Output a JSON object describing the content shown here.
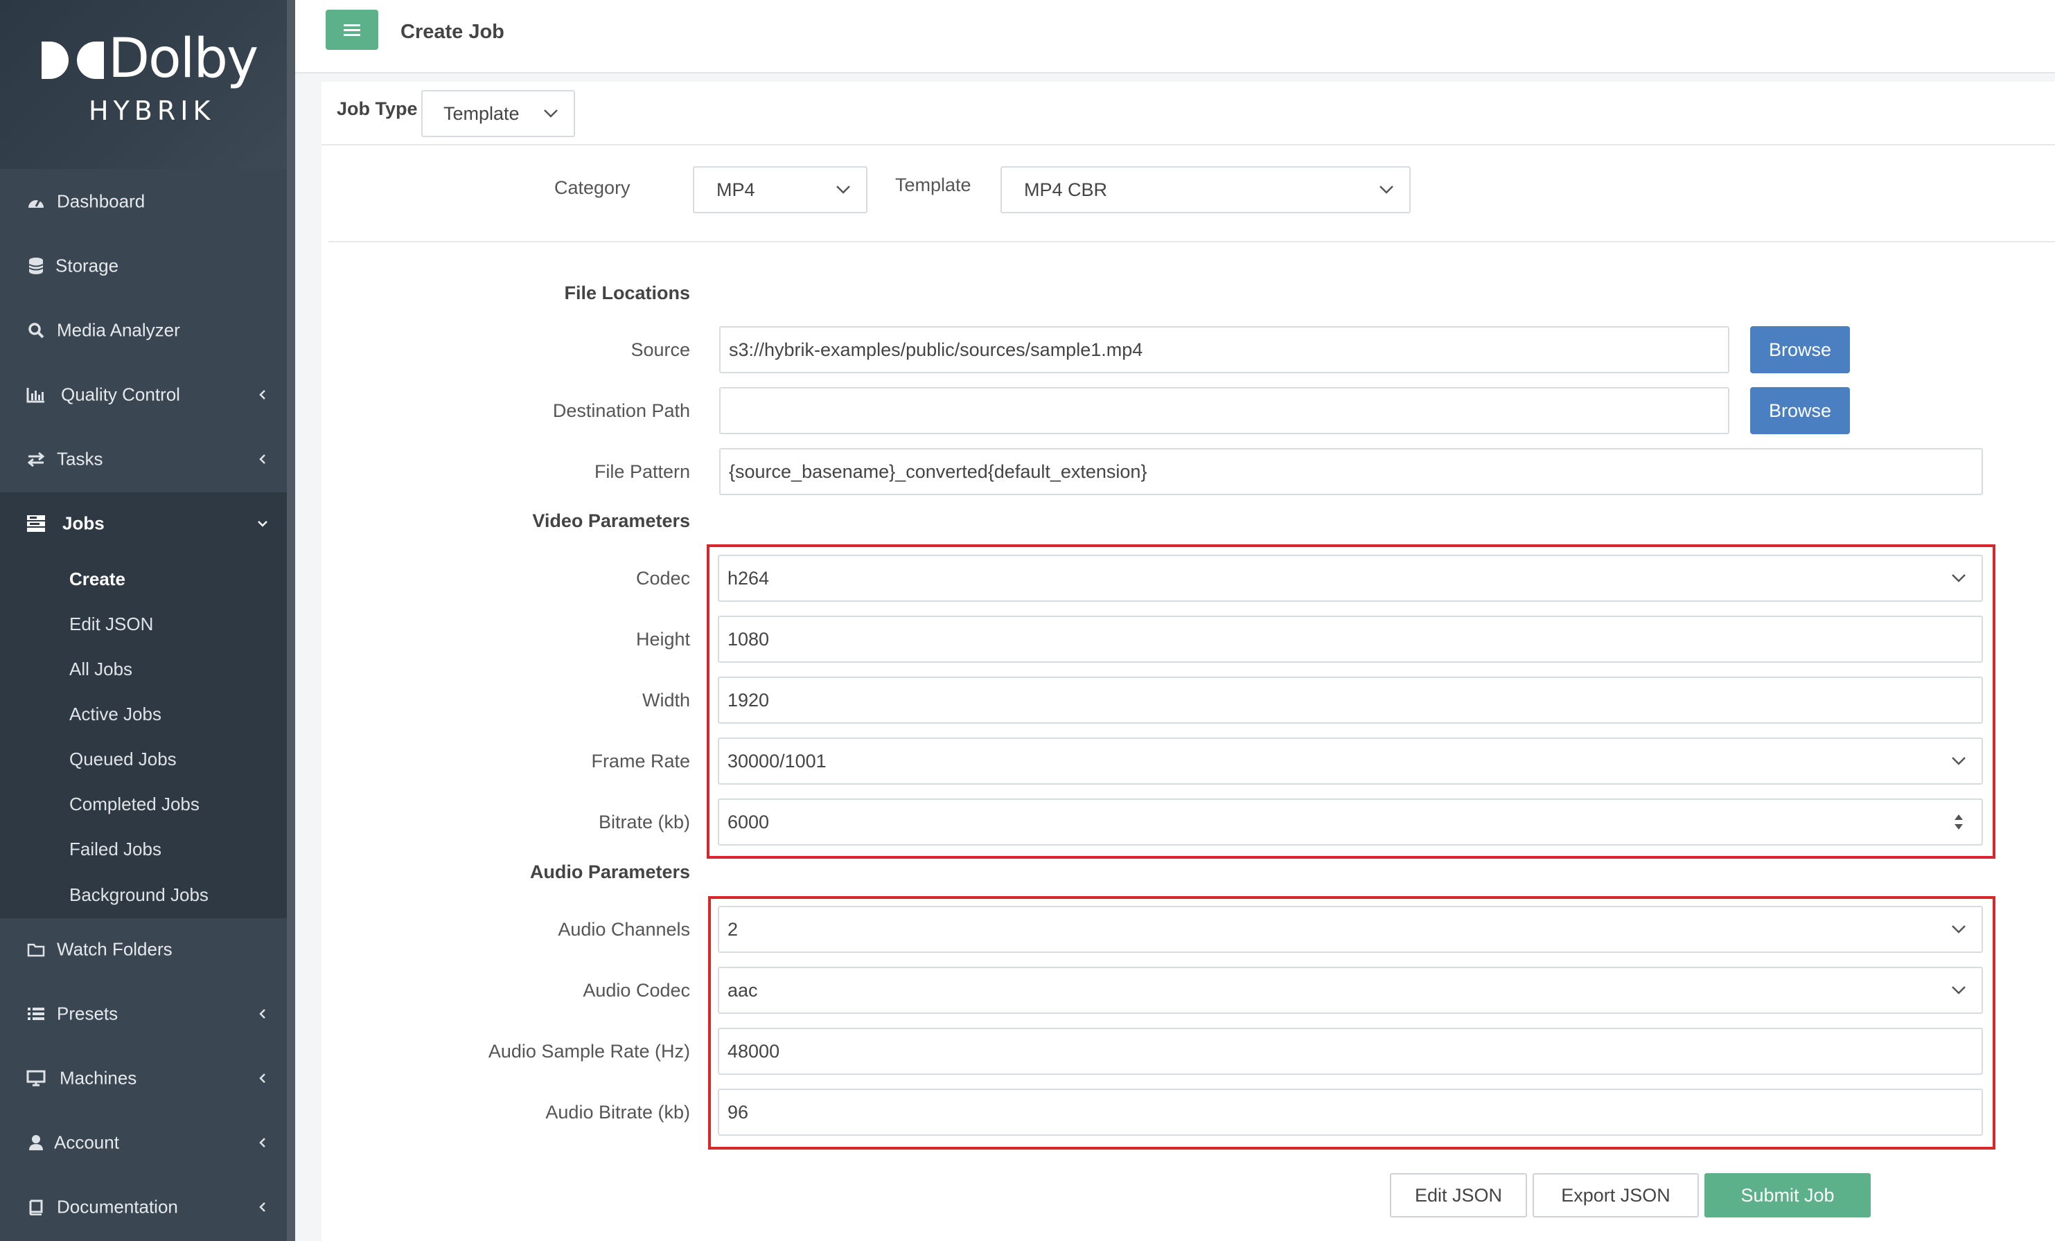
{
  "brand": {
    "name": "Dolby",
    "product": "HYBRIK"
  },
  "sidebar": {
    "items": [
      {
        "label": "Dashboard",
        "icon": "dashboard-icon"
      },
      {
        "label": "Storage",
        "icon": "database-icon"
      },
      {
        "label": "Media Analyzer",
        "icon": "search-icon"
      },
      {
        "label": "Quality Control",
        "icon": "bar-chart-icon",
        "expandable": true
      },
      {
        "label": "Tasks",
        "icon": "exchange-icon",
        "expandable": true
      },
      {
        "label": "Jobs",
        "icon": "jobs-icon",
        "expanded": true
      },
      {
        "label": "Watch Folders",
        "icon": "folder-icon"
      },
      {
        "label": "Presets",
        "icon": "list-icon",
        "expandable": true
      },
      {
        "label": "Machines",
        "icon": "monitor-icon",
        "expandable": true
      },
      {
        "label": "Account",
        "icon": "user-icon",
        "expandable": true
      },
      {
        "label": "Documentation",
        "icon": "book-icon",
        "expandable": true
      }
    ],
    "jobs_submenu": [
      "Create",
      "Edit JSON",
      "All Jobs",
      "Active Jobs",
      "Queued Jobs",
      "Completed Jobs",
      "Failed Jobs",
      "Background Jobs"
    ]
  },
  "header": {
    "title": "Create Job"
  },
  "job_type": {
    "label": "Job Type",
    "value": "Template"
  },
  "template_row": {
    "category_label": "Category",
    "category_value": "MP4",
    "template_label": "Template",
    "template_value": "MP4 CBR"
  },
  "file_locations": {
    "heading": "File Locations",
    "source_label": "Source",
    "source_value": "s3://hybrik-examples/public/sources/sample1.mp4",
    "destination_label": "Destination Path",
    "destination_value": "",
    "pattern_label": "File Pattern",
    "pattern_value": "{source_basename}_converted{default_extension}",
    "browse_label": "Browse"
  },
  "video": {
    "heading": "Video Parameters",
    "codec_label": "Codec",
    "codec_value": "h264",
    "height_label": "Height",
    "height_value": "1080",
    "width_label": "Width",
    "width_value": "1920",
    "framerate_label": "Frame Rate",
    "framerate_value": "30000/1001",
    "bitrate_label": "Bitrate (kb)",
    "bitrate_value": "6000"
  },
  "audio": {
    "heading": "Audio Parameters",
    "channels_label": "Audio Channels",
    "channels_value": "2",
    "codec_label": "Audio Codec",
    "codec_value": "aac",
    "samplerate_label": "Audio Sample Rate (Hz)",
    "samplerate_value": "48000",
    "bitrate_label": "Audio Bitrate (kb)",
    "bitrate_value": "96"
  },
  "actions": {
    "edit_json": "Edit JSON",
    "export_json": "Export JSON",
    "submit": "Submit Job"
  },
  "colors": {
    "accent_green": "#5cb08a",
    "button_blue": "#4a7fc1",
    "highlight_red": "#d9262c",
    "sidebar_bg": "#3a4651"
  }
}
